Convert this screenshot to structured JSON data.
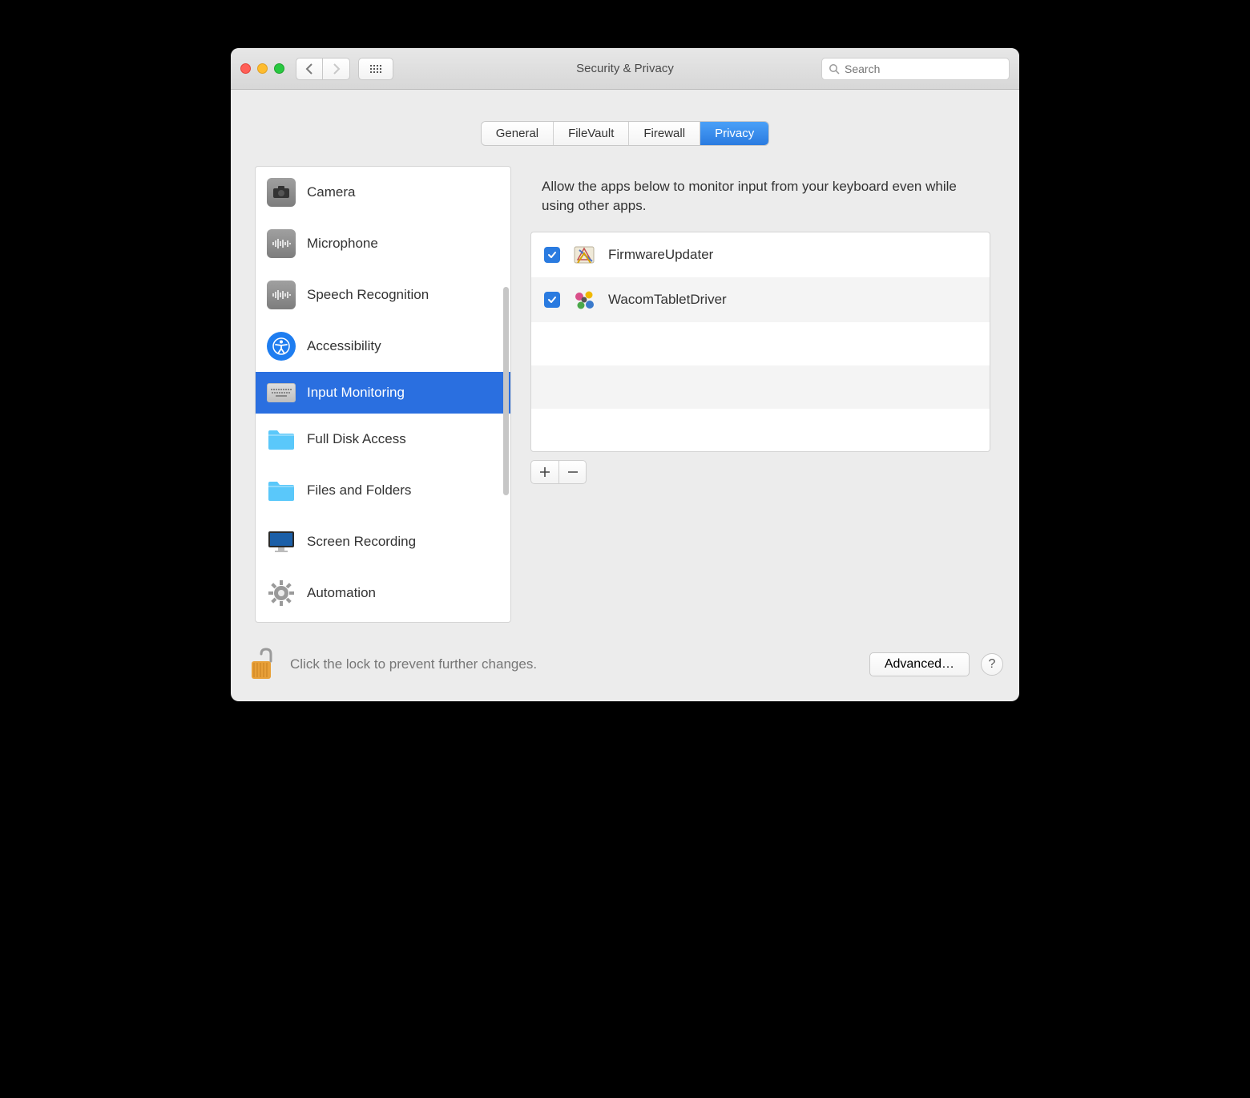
{
  "window": {
    "title": "Security & Privacy"
  },
  "search": {
    "placeholder": "Search"
  },
  "tabs": [
    {
      "label": "General",
      "active": false
    },
    {
      "label": "FileVault",
      "active": false
    },
    {
      "label": "Firewall",
      "active": false
    },
    {
      "label": "Privacy",
      "active": true
    }
  ],
  "sidebar": {
    "items": [
      {
        "label": "Camera",
        "icon": "camera"
      },
      {
        "label": "Microphone",
        "icon": "waveform"
      },
      {
        "label": "Speech Recognition",
        "icon": "waveform"
      },
      {
        "label": "Accessibility",
        "icon": "accessibility"
      },
      {
        "label": "Input Monitoring",
        "icon": "keyboard",
        "selected": true
      },
      {
        "label": "Full Disk Access",
        "icon": "folder"
      },
      {
        "label": "Files and Folders",
        "icon": "folder"
      },
      {
        "label": "Screen Recording",
        "icon": "display"
      },
      {
        "label": "Automation",
        "icon": "gear"
      }
    ]
  },
  "main": {
    "description": "Allow the apps below to monitor input from your keyboard even while using other apps.",
    "apps": [
      {
        "name": "FirmwareUpdater",
        "checked": true,
        "icon": "app-generic"
      },
      {
        "name": "WacomTabletDriver",
        "checked": true,
        "icon": "wacom"
      }
    ]
  },
  "footer": {
    "lock_text": "Click the lock to prevent further changes.",
    "advanced_label": "Advanced…"
  }
}
